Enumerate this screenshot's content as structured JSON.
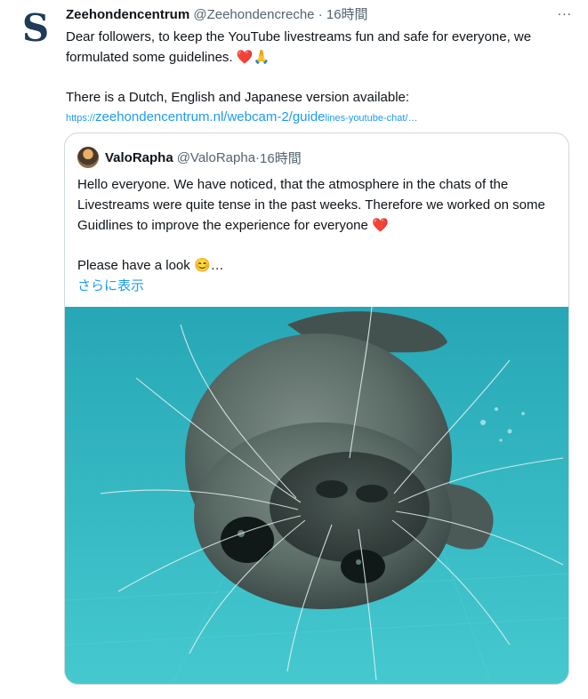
{
  "tweet": {
    "author_name": "Zeehondencentrum",
    "author_handle": "@Zeehondencreche",
    "dot": "·",
    "time": "16時間",
    "more_icon": "...",
    "avatar_icon": "S",
    "text_line1": "Dear followers, to keep the YouTube livestreams fun and safe for everyone, we formulated some guidelines.",
    "text_emoji": "❤️🙏",
    "text_line2": "There is a Dutch, English and Japanese version available:",
    "link_proto": "https://",
    "link_main": "zeehondencentrum.nl/webcam-2/guide",
    "link_tail": "lines-youtube-chat/…"
  },
  "quote": {
    "author_name": "ValoRapha",
    "author_handle": "@ValoRapha",
    "dot": "·",
    "time": "16時間",
    "text_para1": "Hello everyone. We have noticed, that the atmosphere in the chats of the Livestreams were quite tense in the past weeks. Therefore we worked on some Guidlines to improve the experience for everyone",
    "text_para1_emoji": "❤️",
    "text_para2": "Please have a look",
    "text_para2_emoji": "😊…",
    "show_more": "さらに表示",
    "media_subject": "seal underwater photo"
  },
  "colors": {
    "link": "#1d9bf0",
    "secondary_text": "#536471",
    "border": "#cfd9de",
    "water": "#35c0cc"
  }
}
